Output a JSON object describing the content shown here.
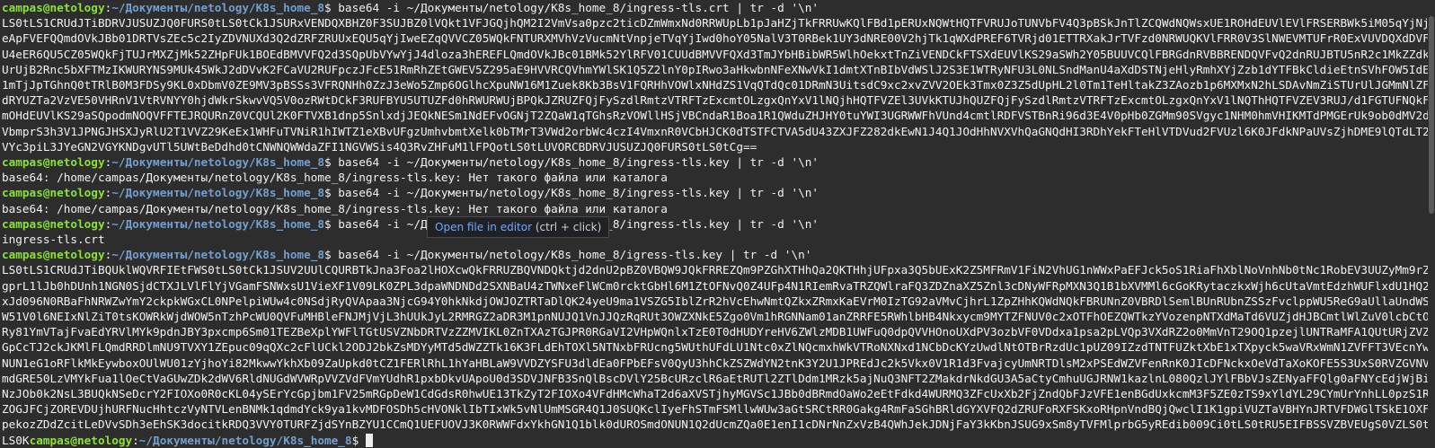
{
  "prompt": {
    "user_host": "campas@netology",
    "sep": ":",
    "path": "~/Документы/netology/K8s_home_8",
    "symbol": "$ "
  },
  "lines": [
    {
      "type": "cmd",
      "text": "base64 -i ~/Документы/netology/K8s_home_8/ingress-tls.crt | tr -d '\\n'"
    },
    {
      "type": "out_b64",
      "text": "LS0tLS1CRUdJTiBDRVJUSUZJQ0FURS0tLS0tCk1JSURxVENDQXBHZ0F3SUJBZ0lVQkt1VFJGQjhQM2I2VmVsa0pzc2ticDZmWmxNd0RRWUpLb1pJaHZjTkFRRUwKQlFBd1pERUxNQWtHQTFVRUJoTUNVbFV4Q3pBSkJnTlZCQWdNQWsxUE1ROHdEUVlEVlFRSERBWk5iM05qYjNjeApFVEFQQmdOVkJBb01DRTVsZEc5c2IyZDVNUXd3Q2dZRFZRUUxEQU5qYjIweEZqQVVCZ05WQkFNTURXMVhVzVucmNtVnpjeTVqYjIwd0hoY05NalV3T0RBek1UY3dNRE00V2hjTk1qWXdPREF6TVRjd01ETTRXakJrTVFzd0NRWUQKVlFRR0V3SlNWEVMTUFrR0ExVUVDQXdDVFU4eER6QU5CZ05WQkFjTUJrMXZjMk52ZHpFUk1BOEdBMVVFQ2d3SQpUbVYwYjJ4dloza3hEREFLQmdOVkJBc01BMk52YlRFV01CUUdBMVVFQXd3TmJYbHBibWR5WlhOekxtTnZiVENDCkFTSXdEUVlKS29aSWh2Y05BUUVCQlFBRGdnRVBBRENDQVFvQ2dnRUJBTU5nR2c1MkZZdkUrUjB2Rnc5bXFTMzIKWURYNS9MUk45WkJ2dDVvK2FCaVU2RUFpczJFcE51RmRhZEtGWEV5Z295aE9HVVRCQVhmYWlSK1Q5Z2lnY0pIRwo3aHkwbnNFeXNwVkI1dmtXTnBIbVdWSlJ2S3E1WTRyNFU3L0NLSndManU4aXdDSTNjeHlyRmhXYjZzb1dYTFBkCldieEtnSVhFOW5IdE1mTjJpTGhnQ0tTRlB0M3FDSy9KL0xDbmV0ZE9MV3pBSSs3VFRQNHh0ZzJ3eWo5Zmp6OGlhcXpuNW16M1Zuek8Kb3BsV1FQRHhVOWlxNHdZS1VqQTdQc01DRmN3UitsdC9xc2xvZVV2OEk3Tmx0Z3Z5dUpHL2l0Tm1TeHltakZ3ZAozb1p6MXMxN2hLSDAvNmZiSTUrUlJGMmNlZFdRYUZTa2VzVE50VHRnV1VtRVNYY0hjdWkrSkwvVQ5V0ozRWtDCkF3RUFBYU5UTUZFd0hRWURWUjBPQkJZRUZFQjFySzdlRmtzVTRFTzExcmtOLzgxQnYxV1lNQjhHQTFVZEl3UVkKTUJhQUZFQjFySzdlRmtzVTRFTzExcmtOLzgxQnYxV1lNQThHQTFVZEV3RUJ/d1FGTUFNQkFmOHdEUVlKS29aSQpodmNOQVFFTEJRQURnZ0VCQUl2K0FTVXB1dnp5SnlxdjJEQkNESm1NdEFvOGNjT2ZQaW1qTGhsRzVOWllHSjVBCndaR1Boa1R1QWduZHJHY0tuYWI3UGRWWFhVUnd4cmtlRDFVSTBnRi96d3E4V0pHb0ZGMm90SVgyc1NHM0hmVHIKMTdPMGErUk9ob0dMV2dVbmprS3h3V1JPNGJHSXJyRlU2T1VVZ29KeEx1WHFuTVNiR1hIWTZ1eXBvUFgzUmhvbmtXelk0bTMrT3VWd2orbWc4czI4VmxnR0VCbHJCK0dTSTFCTVA5dU43ZXJFZ282dkEwN1J4Q1JOdHhNVXVhQaGNQdHI3RDhYekFTeHlVTDVud2FVUzl6K0JFdkNPaUVsZjhDME9lQTdLT2VYc3piL3JYeGN2VGYKNDgvUTl5UWtBeDdhd0tCNWNQWWdaZFI1NGVWSis4Q3RvZHFuM1lFPQotLS0tLUVORCBDRVJUSUZJQ0FURS0tLS0tCg=="
    },
    {
      "type": "cmd",
      "text": "base64 -i ~/Документы/netology/K8s_home_8/ingress-tls.key | tr -d '\\n'"
    },
    {
      "type": "out",
      "text": "base64: /home/campas/Документы/netology/K8s_home_8/ingress-tls.key: Нет такого файла или каталога"
    },
    {
      "type": "cmd",
      "text": "base64 -i ~/Документы/netology/K8s_home_8/ingress-tls.key | tr -d '\\n'"
    },
    {
      "type": "out",
      "text": "base64: /home/campas/Документы/netology/K8s_home_8/ingress-tls.key: Нет такого файла или каталога"
    },
    {
      "type": "cmd",
      "text": "base64 -i ~/Документы/netology/K8s_home_8/ingress-tls.key | tr -d '\\n'"
    },
    {
      "type": "out",
      "text": "ingress-tls.crt"
    },
    {
      "type": "cmd",
      "text": "base64 -i ~/Документы/netology/K8s_home_8/igress-tls.key | tr -d '\\n'"
    },
    {
      "type": "out_b64",
      "text": "LS0tLS1CRUdJTiBQUklWQVRFIEtFWS0tLS0tCk1JSUV2UUlCQURBTkJna3Foa2lHOXcwQkFRRUZBQVNDQktjd2dnU2pBZ0VBQW9JQkFRREZQm9PZGhXTHhQa2QKTHhjUFpxa3Q5bUExK2Z5MFRmV1FiN2VhUG1nWWxPaEFJck5oS1RiaFhXblNoVnhNb0tNc1RobEV3UUZyMm9rZgprL1lJb0hDUnh1NGN0SjdCTXJLVlFlYjVGamFSNWxsU1VieXF1V09LK0ZPL3dpaWNDNDd2SXNBaU4zTWNxeFlWCm0rcktGbHl6M1ZtOFNvQ0Z4UFp4N1RIemRvaTRZQWlraFQ3ZDZnaXZ5Znl3cDNyWFRpMXN3Q1B1bXVMMl6cGoKRytaczkxWjh6cUtaVmtEdzhWUFlxdU1HQ2xJd096N0RBaFhNRWZwYmY2ckpkWGxCL0NPelpiWUw4c0NSdjRyQVApaa3NjcG94Y0hkNkdjOWJOZTRTaDlQK24yeU9ma1VSZG5IblZrR2hVcEhwNmtQZkxZRmxKaEVrM0IzTG92aVMvCjhrL1ZpZHhKQWdNQkFBRUNnZ0VBRDlSemlBUnRUbnZSSzFvclppWU5ReG9aUllaUndWSW51V0l6NEIxNlZiT0tsKOWRkWjdWOW5nTzhPcWU0QVFuMHBleFNJMjVjL3hUUkJyL2RMRGZ2aDR3M1pnNUJQ1VnJJQzRqRUt3OWZXNkE5Zgo0Vm1hRGNNam01anZRRFE5RWhlbHB4Nkxycm9MYTZFNUV0c2xOTFhOEZQWTkzYVozenpNTXdMaTd6VUZjdHJBCmtlWlZuV0lcbCtORy81YmVTajFvaEdYRVlMYk9pdnJBY3pxcmp6Sm01TEZBeXplYWFlTGtUSVZNbDRTVzZZMVIKL0ZnTXAzTGJPR0RGaVI2VHpWQnlxTzE0T0dHUDYreHV6ZWlzMDB1UWFuQ0dpQVVHOnoUXdPV3ozbVF0VDdxa1psa2pLVQp3VXdRZ2o0MmVnT29OQ1pzejlUNTRaMFA1QUtURjZVZGpCcTJ2ckJKMlFLQmdRRDlmNU9TVXY1ZEpuc09qQXc2cFlUCkl2ODJ2bkZsMDYyMTd5dWZZTk16K3FLdEhTOXl5NTNxbFRUcng5WUthUFdLU1Ntc0xZlNQcmxhWkVTRoNXNxd1NCbDcKYzUwdlNtOTBrRzdUc1pUZ09IZzdTNTFUZktXbE1xTXpyck5waVRxWmN1ZVFFT3VEcnYwNUN1eG1oRFlkMkEywboxOUlWU01zYjhoYi82MkwwYkhXb09ZaUpkd0tCZ1FERlRhL1hYaHBLaW9VVDZYSFU3dldEa0FPbEFsV0QyU3hhCkZSZWdYN2tnK3Y2U1JPREdJc2k5Vkx0V1R1d3FvajcyUmNRTDlsM2xPSEdWZVFenRnK0JIcDFNckxOeVdTaXoKOFE5S3UxS0RVZGVNVmdGRE50LzVMYkFua1lOeCtVaGUwZDk2dWV6RldNUGdWVWRpVVZVdFVmYUdhR1pxbDkvUApoU0d3SDVJNFB3SnQlBscDVlY25BcURzclR6aEtRUTl2ZTlDdm1MRzk5ajNuQ3NFT2ZMakdrNkdGU3A5aCtyCmhuUGJRNW1kazlnL080QzlJYlFBbVJsZENyaFFQlg0aFNYcEdjWjBiNzJOb0k2NsL3BUQkNSeDcrY2FIOXo0R0cKL04ySErYcGpjbm1FV25mRGpDeW1CdGdsR0hwUE13TkZyT2FIOXo4VFdHMcWhaT2d6aXVSTjhyMGVSc1JBb0dBRmdOaWo2eEtFdkd4WURMQ3ZFcUxXb2FjZndQbFJzVFE1enBGdUxkcmM3F5ZE0zTS9xYldYL29CYmUrYnhLL0pzS1RZOGJFCjZOREVDUjhURFNucHhtczVyNTVLenBNMk1qdmdYck9ya1kvMDFOSDh5cHVONklIbTIxWk5vNlUmMSGR4Q1J0SUQKclIyeFhSTmFSMllwWUw3aGtSRCtRR0Gakg4RmFaSGhBRldGYXVFQ2dZRUFoRXFSKxoRHpnVndBQjQwclI1K1gpiVUZTaVBHYnJRTVFDWGlTSkE1OXFpekozZDdZcitLeDVvSDh3eEhSK3docitkRDQ3VVY0TURFZjdSYnBZYU1CCmQ1UEFUOVJ3K0RWWFdxYkhGN1Q1blk0dUROSmdONUN1Q2dUcmZQa0E1enI1cDNrNnZxVzB4QWhJekJDNjFaY3kKbnJSUG9xSm8yTVFMlprbG5yREdib009Ci0tLS0tRU5EIFBSSVZBVEUgS0VZLS0tLS0K"
    }
  ],
  "trailing_prompt": true,
  "tooltip": {
    "link": "Open file in editor",
    "hint": "(ctrl + click)"
  }
}
